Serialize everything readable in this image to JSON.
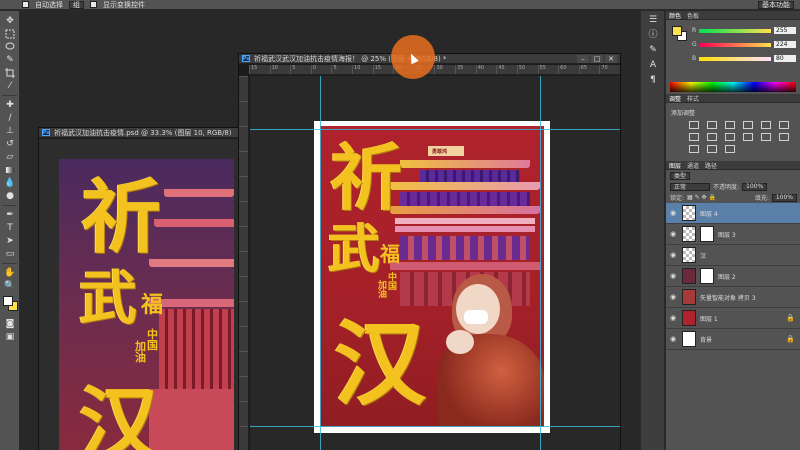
{
  "options_bar": {
    "auto_select_label": "自动选择",
    "auto_select_value": "组",
    "show_transform_label": "显示变换控件",
    "workspace": "基本功能"
  },
  "toolbar": {
    "tools": [
      "move-icon",
      "marquee-icon",
      "lasso-icon",
      "quick-select-icon",
      "crop-icon",
      "eyedropper-icon",
      "healing-icon",
      "brush-icon",
      "stamp-icon",
      "history-brush-icon",
      "eraser-icon",
      "gradient-icon",
      "blur-icon",
      "dodge-icon",
      "pen-icon",
      "type-icon",
      "path-select-icon",
      "shape-icon",
      "hand-icon",
      "zoom-icon"
    ],
    "foreground_color": "#ffffff",
    "background_color": "#ffe050"
  },
  "documents": {
    "back": {
      "title": "祈福武汉加油抗击疫情.psd @ 33.3% (图层 10, RGB/8)"
    },
    "front": {
      "title": "祈福武汉武汉加油抗击疫情海报！ @ 25% (图层 4, RGB/8) *",
      "ruler_ticks": [
        "15",
        "10",
        "5",
        "0",
        "5",
        "10",
        "15",
        "20",
        "25",
        "30",
        "35",
        "40",
        "45",
        "50",
        "55",
        "60",
        "65",
        "70"
      ]
    }
  },
  "poster": {
    "big_chars": [
      "祈",
      "武",
      "汉"
    ],
    "small_char": "福",
    "vertical_text": [
      "中",
      "国",
      "加",
      "油"
    ],
    "seal_text": "勇敢鸿"
  },
  "colors_panel": {
    "tabs": [
      "颜色",
      "色板"
    ],
    "sliders": [
      {
        "label": "R",
        "value": "255"
      },
      {
        "label": "G",
        "value": "224"
      },
      {
        "label": "B",
        "value": "80"
      }
    ],
    "fg": "#ffe050",
    "bg": "#ffffff"
  },
  "adjustments_panel": {
    "tabs": [
      "调整",
      "样式"
    ],
    "title": "添加调整"
  },
  "layers_panel": {
    "tabs": [
      "图层",
      "通道",
      "路径"
    ],
    "filter_label": "类型",
    "blend_mode": "正常",
    "opacity_label": "不透明度:",
    "opacity_value": "100%",
    "lock_label": "锁定:",
    "fill_label": "填充:",
    "fill_value": "100%",
    "layers": [
      {
        "name": "图层 4",
        "selected": true,
        "thumb": "checker",
        "mask": false
      },
      {
        "name": "图层 3",
        "selected": false,
        "thumb": "checker",
        "mask": true
      },
      {
        "name": "汉",
        "selected": false,
        "thumb": "checker",
        "mask": false
      },
      {
        "name": "图层 2",
        "selected": false,
        "thumb": "#6a2a3c",
        "mask": true
      },
      {
        "name": "矢量智能对象 拷贝 3",
        "selected": false,
        "thumb": "#a63a38",
        "mask": false
      },
      {
        "name": "图层 1",
        "selected": false,
        "thumb": "#b0222c",
        "mask": false,
        "locked": true
      },
      {
        "name": "背景",
        "selected": false,
        "thumb": "#ffffff",
        "mask": false,
        "locked": true
      }
    ]
  }
}
